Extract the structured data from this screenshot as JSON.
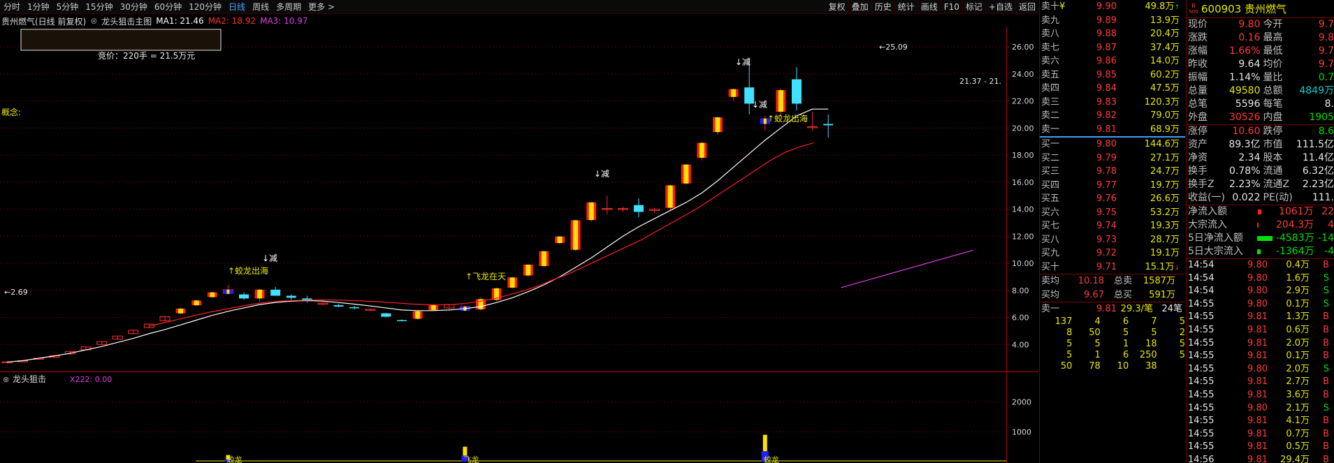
{
  "toolbar": {
    "periods": [
      "分时",
      "1分钟",
      "5分钟",
      "15分钟",
      "30分钟",
      "60分钟",
      "120分钟",
      "日线",
      "周线",
      "多周期",
      "更多 >"
    ],
    "active_period": "日线",
    "buttons": [
      "复权",
      "叠加",
      "历史",
      "统计",
      "画线",
      "F10",
      "标记",
      "+自选",
      "返回"
    ]
  },
  "chart_info": {
    "title": "贵州燃气(日线 前复权)",
    "indicator_name": "龙头狙击主图",
    "ma1": "MA1: 21.46",
    "ma2": "MA2: 18.92",
    "ma3": "MA3: 10.97",
    "colors": {
      "ma1": "#ffffff",
      "ma2": "#ff3030",
      "ma3": "#e040e0",
      "up": "#ff2020",
      "down": "#40e0ff",
      "accent": "#e8e800"
    }
  },
  "main_chart": {
    "auction_text": "竞价：220手 = 21.5万元",
    "concept_label": "概念:",
    "y_ticks": [
      "26.00",
      "24.00",
      "22.00",
      "20.00",
      "18.00",
      "16.00",
      "14.00",
      "12.00",
      "10.00",
      "8.00",
      "6.00",
      "4.00"
    ],
    "y_values": [
      26,
      24,
      22,
      20,
      18,
      16,
      14,
      12,
      10,
      8,
      6,
      4
    ],
    "low_label": "←2.69",
    "high_label": "←25.09",
    "right_label": "21.37 - 21.",
    "annotations": [
      {
        "text": "↓减",
        "x": 375,
        "y": 336
      },
      {
        "text": "↓减",
        "x": 850,
        "y": 215
      },
      {
        "text": "↓减",
        "x": 1052,
        "y": 55
      },
      {
        "text": "↓减",
        "x": 1076,
        "y": 116
      },
      {
        "text": "↑蛟龙出海",
        "x": 326,
        "y": 354
      },
      {
        "text": "↑飞龙在天",
        "x": 666,
        "y": 362
      },
      {
        "text": "↑蛟龙出海",
        "x": 1098,
        "y": 136
      }
    ]
  },
  "sub_chart": {
    "name": "龙头狙击",
    "x222": "X222: 0.00",
    "y_ticks": [
      "2000",
      "1000"
    ],
    "labels": [
      "蛟龙",
      "飞龙",
      "蛟龙"
    ]
  },
  "orderbook": {
    "asks": [
      {
        "label": "卖十",
        "sym": "¥",
        "price": "9.90",
        "vol": "49.8万",
        "mark": "↑"
      },
      {
        "label": "卖九",
        "price": "9.89",
        "vol": "13.9万"
      },
      {
        "label": "卖八",
        "price": "9.88",
        "vol": "20.4万"
      },
      {
        "label": "卖七",
        "price": "9.87",
        "vol": "37.4万"
      },
      {
        "label": "卖六",
        "price": "9.86",
        "vol": "14.0万"
      },
      {
        "label": "卖五",
        "price": "9.85",
        "vol": "60.2万"
      },
      {
        "label": "卖四",
        "price": "9.84",
        "vol": "47.5万"
      },
      {
        "label": "卖三",
        "price": "9.83",
        "vol": "120.3万"
      },
      {
        "label": "卖二",
        "price": "9.82",
        "vol": "79.0万"
      },
      {
        "label": "卖一",
        "price": "9.81",
        "vol": "68.9万"
      }
    ],
    "bids": [
      {
        "label": "买一",
        "price": "9.80",
        "vol": "144.6万"
      },
      {
        "label": "买二",
        "price": "9.79",
        "vol": "27.1万"
      },
      {
        "label": "买三",
        "price": "9.78",
        "vol": "24.7万"
      },
      {
        "label": "买四",
        "price": "9.77",
        "vol": "19.7万"
      },
      {
        "label": "买五",
        "price": "9.76",
        "vol": "26.6万"
      },
      {
        "label": "买六",
        "price": "9.75",
        "vol": "53.2万"
      },
      {
        "label": "买七",
        "price": "9.74",
        "vol": "19.3万"
      },
      {
        "label": "买八",
        "price": "9.73",
        "vol": "28.7万"
      },
      {
        "label": "买九",
        "price": "9.72",
        "vol": "19.1万"
      },
      {
        "label": "买十",
        "price": "9.71",
        "vol": "15.1万",
        "mark": "↓"
      }
    ],
    "avg": [
      {
        "label": "卖均",
        "price": "10.18",
        "label2": "总卖",
        "vol": "1587万"
      },
      {
        "label": "买均",
        "price": "9.67",
        "label2": "总买",
        "vol": "591万"
      }
    ],
    "ask1_line": {
      "label": "卖一",
      "price": "9.81",
      "mid": "29.3/笔",
      "count": "24笔"
    },
    "queue": [
      [
        "137",
        "4",
        "6",
        "7",
        "5"
      ],
      [
        "8",
        "50",
        "5",
        "5",
        "2"
      ],
      [
        "5",
        "5",
        "1",
        "18",
        "5"
      ],
      [
        "5",
        "1",
        "6",
        "250",
        "5"
      ],
      [
        "50",
        "78",
        "10",
        "38",
        ""
      ]
    ]
  },
  "quote": {
    "badge_top": "R",
    "badge_bottom": "500",
    "code_name": "600903 贵州燃气",
    "rows": [
      {
        "l1": "现价",
        "v1": "9.80",
        "c1": "up",
        "l2": "今开",
        "v2": "9.7",
        "c2": "up"
      },
      {
        "l1": "涨跌",
        "v1": "0.16",
        "c1": "up",
        "l2": "最高",
        "v2": "9.8",
        "c2": "up"
      },
      {
        "l1": "涨幅",
        "v1": "1.66%",
        "c1": "up",
        "l2": "最低",
        "v2": "9.7",
        "c2": "up"
      },
      {
        "l1": "昨收",
        "v1": "9.64",
        "c1": "white",
        "l2": "均价",
        "v2": "9.7",
        "c2": "up"
      },
      {
        "l1": "振幅",
        "v1": "1.14%",
        "c1": "white",
        "l2": "量比",
        "v2": "0.7",
        "c2": "down"
      },
      {
        "l1": "总量",
        "v1": "49580",
        "c1": "yel",
        "l2": "总额",
        "v2": "4849万",
        "c2": "cyan"
      },
      {
        "l1": "总笔",
        "v1": "5596",
        "c1": "white",
        "l2": "每笔",
        "v2": "8.",
        "c2": "white"
      },
      {
        "l1": "外盘",
        "v1": "30526",
        "c1": "up",
        "l2": "内盘",
        "v2": "1905",
        "c2": "down"
      }
    ],
    "rows2": [
      {
        "l1": "涨停",
        "v1": "10.60",
        "c1": "up",
        "l2": "跌停",
        "v2": "8.6",
        "c2": "down"
      },
      {
        "l1": "资产",
        "v1": "89.3亿",
        "c1": "white",
        "l2": "市值",
        "v2": "111.5亿",
        "c2": "white"
      },
      {
        "l1": "净资",
        "v1": "2.34",
        "c1": "white",
        "l2": "股本",
        "v2": "11.4亿",
        "c2": "white"
      },
      {
        "l1": "换手",
        "v1": "0.78%",
        "c1": "white",
        "l2": "流通",
        "v2": "6.32亿",
        "c2": "white"
      },
      {
        "l1": "换手Z",
        "v1": "2.23%",
        "c1": "white",
        "l2": "流通Z",
        "v2": "2.23亿",
        "c2": "white"
      },
      {
        "l1": "收益(一)",
        "v1": "0.022",
        "c1": "white",
        "l2": "PE(动)",
        "v2": "111.",
        "c2": "white"
      }
    ],
    "flows": [
      {
        "label": "净流入额",
        "val": "1061万",
        "c": "up",
        "val2": "22",
        "c2": "up",
        "bar": "red-small"
      },
      {
        "label": "大宗流入",
        "val": "204.3万",
        "c": "up",
        "val2": "4",
        "c2": "up",
        "bar": "red-tiny"
      },
      {
        "label": "5日净流入额",
        "val": "-4583万",
        "c": "down",
        "val2": "-14",
        "c2": "down",
        "bar": "green-big"
      },
      {
        "label": "5日大宗流入",
        "val": "-1364万",
        "c": "down",
        "val2": "-4",
        "c2": "down",
        "bar": "green-small"
      }
    ],
    "ticks": [
      {
        "t": "14:54",
        "p": "9.80",
        "v": "0.4万",
        "f": "B"
      },
      {
        "t": "14:54",
        "p": "9.80",
        "v": "1.6万",
        "f": "S"
      },
      {
        "t": "14:54",
        "p": "9.80",
        "v": "2.9万",
        "f": "S"
      },
      {
        "t": "14:55",
        "p": "9.80",
        "v": "0.1万",
        "f": "S"
      },
      {
        "t": "14:55",
        "p": "9.81",
        "v": "1.3万",
        "f": "B"
      },
      {
        "t": "14:55",
        "p": "9.81",
        "v": "0.6万",
        "f": "B"
      },
      {
        "t": "14:55",
        "p": "9.81",
        "v": "2.0万",
        "f": "B"
      },
      {
        "t": "14:55",
        "p": "9.81",
        "v": "0.1万",
        "f": "B"
      },
      {
        "t": "14:55",
        "p": "9.80",
        "v": "2.0万",
        "f": "S"
      },
      {
        "t": "14:55",
        "p": "9.81",
        "v": "2.7万",
        "f": "B"
      },
      {
        "t": "14:55",
        "p": "9.81",
        "v": "3.6万",
        "f": "B"
      },
      {
        "t": "14:55",
        "p": "9.80",
        "v": "2.1万",
        "f": "S"
      },
      {
        "t": "14:55",
        "p": "9.81",
        "v": "4.1万",
        "f": "B"
      },
      {
        "t": "14:55",
        "p": "9.81",
        "v": "0.7万",
        "f": "B"
      },
      {
        "t": "14:55",
        "p": "9.81",
        "v": "0.5万",
        "f": "B"
      },
      {
        "t": "14:56",
        "p": "9.81",
        "v": "29.4万",
        "f": "B"
      }
    ]
  },
  "chart_data": {
    "type": "candlestick",
    "candles": [
      [
        2.7,
        2.69,
        2.75,
        2.72
      ],
      [
        2.72,
        2.7,
        2.82,
        2.8
      ],
      [
        2.9,
        2.88,
        3.0,
        2.98
      ],
      [
        3.05,
        3.02,
        3.2,
        3.17
      ],
      [
        3.3,
        3.27,
        3.5,
        3.48
      ],
      [
        3.6,
        3.57,
        3.85,
        3.82
      ],
      [
        4.0,
        3.95,
        4.22,
        4.2
      ],
      [
        4.4,
        4.35,
        4.65,
        4.62
      ],
      [
        4.8,
        4.75,
        5.08,
        5.05
      ],
      [
        5.25,
        5.2,
        5.55,
        5.5
      ],
      [
        5.75,
        5.7,
        6.1,
        6.05
      ],
      [
        6.3,
        6.25,
        6.7,
        6.65
      ],
      [
        6.9,
        6.85,
        7.3,
        7.25
      ],
      [
        7.5,
        7.45,
        7.9,
        7.85
      ],
      [
        7.8,
        7.7,
        8.4,
        8.05
      ],
      [
        7.7,
        7.3,
        7.85,
        7.4
      ],
      [
        7.4,
        7.15,
        8.1,
        8.05
      ],
      [
        8.05,
        7.9,
        8.25,
        7.6
      ],
      [
        7.6,
        7.3,
        7.7,
        7.45
      ],
      [
        7.4,
        7.1,
        7.6,
        7.2
      ],
      [
        7.0,
        6.9,
        7.1,
        7.05
      ],
      [
        6.9,
        6.75,
        7.0,
        6.8
      ],
      [
        6.75,
        6.6,
        6.85,
        6.7
      ],
      [
        6.6,
        6.5,
        6.65,
        6.6
      ],
      [
        6.3,
        6.0,
        6.35,
        6.05
      ],
      [
        5.8,
        5.7,
        5.85,
        5.78
      ],
      [
        5.9,
        5.85,
        6.5,
        6.45
      ],
      [
        6.55,
        6.5,
        7.0,
        6.95
      ],
      [
        6.7,
        6.6,
        7.0,
        6.95
      ],
      [
        6.6,
        6.55,
        6.85,
        6.8
      ],
      [
        6.6,
        6.5,
        7.5,
        7.35
      ],
      [
        7.3,
        7.2,
        8.2,
        8.15
      ],
      [
        8.2,
        8.15,
        9.0,
        8.95
      ],
      [
        9.1,
        9.0,
        9.9,
        9.9
      ],
      [
        9.8,
        9.7,
        10.9,
        10.89
      ],
      [
        11.5,
        11.4,
        12.0,
        11.98
      ],
      [
        11.0,
        10.9,
        13.2,
        13.18
      ],
      [
        13.2,
        13.1,
        14.5,
        14.5
      ],
      [
        14.0,
        13.6,
        15.0,
        14.05
      ],
      [
        14.0,
        13.8,
        14.2,
        14.05
      ],
      [
        14.3,
        13.4,
        14.8,
        13.8
      ],
      [
        13.9,
        13.7,
        14.1,
        14.0
      ],
      [
        14.1,
        13.9,
        15.8,
        15.76
      ],
      [
        15.9,
        15.8,
        17.3,
        17.3
      ],
      [
        17.8,
        17.6,
        19.0,
        18.9
      ],
      [
        19.7,
        19.5,
        20.8,
        20.79
      ],
      [
        22.3,
        22.0,
        22.9,
        22.87
      ],
      [
        23.0,
        21.0,
        25.09,
        21.8
      ],
      [
        20.3,
        19.8,
        20.9,
        20.7
      ],
      [
        21.2,
        20.9,
        22.9,
        22.8
      ],
      [
        23.6,
        21.3,
        24.5,
        21.8
      ],
      [
        20.1,
        19.8,
        21.2,
        20.1
      ],
      [
        20.3,
        19.3,
        21.0,
        20.2
      ]
    ],
    "ma1": [
      [
        2.7,
        2.8,
        2.98,
        3.15,
        3.35,
        3.6,
        3.85,
        4.15,
        4.45,
        4.8,
        5.1,
        5.45,
        5.8,
        6.15,
        6.45,
        6.7,
        6.95,
        7.1,
        7.2,
        7.25,
        7.2,
        7.1,
        6.98,
        6.85,
        6.7,
        6.55,
        6.5,
        6.5,
        6.55,
        6.65,
        6.8,
        7.1,
        7.45,
        7.9,
        8.4,
        9.0,
        9.7,
        10.4,
        11.2,
        12.0,
        12.7,
        13.3,
        13.9,
        14.5,
        15.2,
        16.1,
        17.1,
        18.1,
        19.1,
        20.0,
        20.9,
        21.4,
        21.4
      ]
    ],
    "ma2_start": 9,
    "ma2": [
      5.35,
      5.6,
      5.85,
      6.1,
      6.35,
      6.55,
      6.75,
      6.95,
      7.1,
      7.2,
      7.25,
      7.28,
      7.3,
      7.28,
      7.25,
      7.2,
      7.15,
      7.08,
      7.0,
      6.95,
      6.92,
      6.95,
      7.05,
      7.2,
      7.4,
      7.7,
      8.0,
      8.35,
      8.8,
      9.2,
      9.7,
      10.2,
      10.7,
      11.2,
      11.7,
      12.3,
      12.9,
      13.5,
      14.1,
      14.8,
      15.5,
      16.2,
      16.9,
      17.6,
      18.2,
      18.6,
      18.9
    ],
    "ma3_line": [
      [
        36,
        8.2
      ],
      [
        51,
        10.97
      ]
    ],
    "sub_bars": [
      {
        "i": 14,
        "yellow": 220,
        "blue": 80
      },
      {
        "i": 29,
        "yellow": 500,
        "blue": 200
      },
      {
        "i": 48,
        "yellow": 900,
        "blue": 350
      }
    ],
    "ylim": [
      2.0,
      27.5
    ]
  }
}
